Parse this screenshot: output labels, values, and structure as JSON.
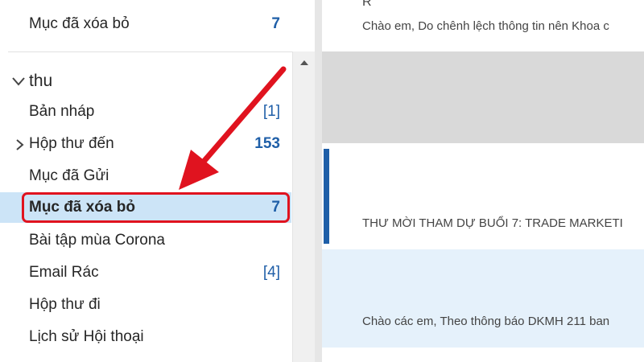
{
  "folder_pane": {
    "top_item": {
      "label": "Mục đã xóa bỏ",
      "count": "7"
    },
    "account": {
      "name": "thu"
    },
    "folders": [
      {
        "label": "Bản nháp",
        "count": "[1]",
        "count_bold": false
      },
      {
        "label": "Hộp thư đến",
        "count": "153",
        "count_bold": true
      },
      {
        "label": "Mục đã Gửi",
        "count": "",
        "count_bold": false
      },
      {
        "label": "Mục đã xóa bỏ",
        "count": "7",
        "count_bold": true,
        "selected": true
      },
      {
        "label": "Bài tập mùa Corona",
        "count": "",
        "count_bold": false
      },
      {
        "label": "Email Rác",
        "count": "[4]",
        "count_bold": false
      },
      {
        "label": "Hộp thư đi",
        "count": "",
        "count_bold": false
      },
      {
        "label": "Lịch sử Hội thoại",
        "count": "",
        "count_bold": false
      }
    ]
  },
  "message_list": {
    "messages": [
      {
        "sender": "R",
        "preview": "Chào em,  Do chênh lệch thông tin nên Khoa c"
      },
      {
        "sender": "",
        "preview": ""
      },
      {
        "sender": "",
        "preview": "THƯ MỜI THAM DỰ BUỔI 7:  TRADE MARKETI"
      },
      {
        "sender": "",
        "preview": "Chào các em,  Theo thông báo DKMH 211 ban"
      }
    ]
  },
  "colors": {
    "accent_blue": "#1f5fa8",
    "selection": "#cce4f7",
    "annotation_red": "#e0131f",
    "unread_bar": "#1f5fa8"
  }
}
